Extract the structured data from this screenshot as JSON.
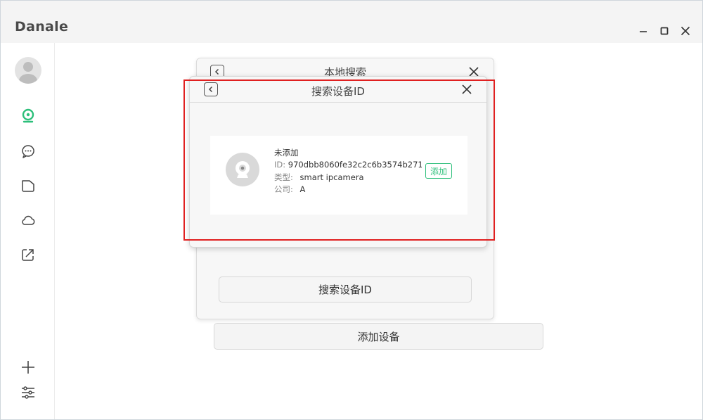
{
  "app": {
    "title": "Danale"
  },
  "window_controls": [
    "minimize-icon",
    "maximize-icon",
    "close-icon"
  ],
  "sidebar": {
    "items": [
      {
        "icon": "camera-icon",
        "active": true
      },
      {
        "icon": "message-icon",
        "active": false
      },
      {
        "icon": "folder-icon",
        "active": false
      },
      {
        "icon": "cloud-icon",
        "active": false
      },
      {
        "icon": "share-icon",
        "active": false
      }
    ],
    "bottom": [
      "add-icon",
      "settings-sliders-icon"
    ]
  },
  "local_search_dialog": {
    "title": "本地搜索",
    "search_id_button": "搜索设备ID"
  },
  "add_device_button": "添加设备",
  "device_id_dialog": {
    "title": "搜索设备ID",
    "device": {
      "status": "未添加",
      "id_label": "ID:",
      "id_value": "970dbb8060fe32c2c6b3574b271f",
      "type_label": "类型:",
      "type_value": "smart ipcamera",
      "company_label": "公司:",
      "company_value": "A",
      "add_label": "添加"
    }
  },
  "colors": {
    "accent": "#2cbf7a",
    "highlight": "#e02020"
  }
}
